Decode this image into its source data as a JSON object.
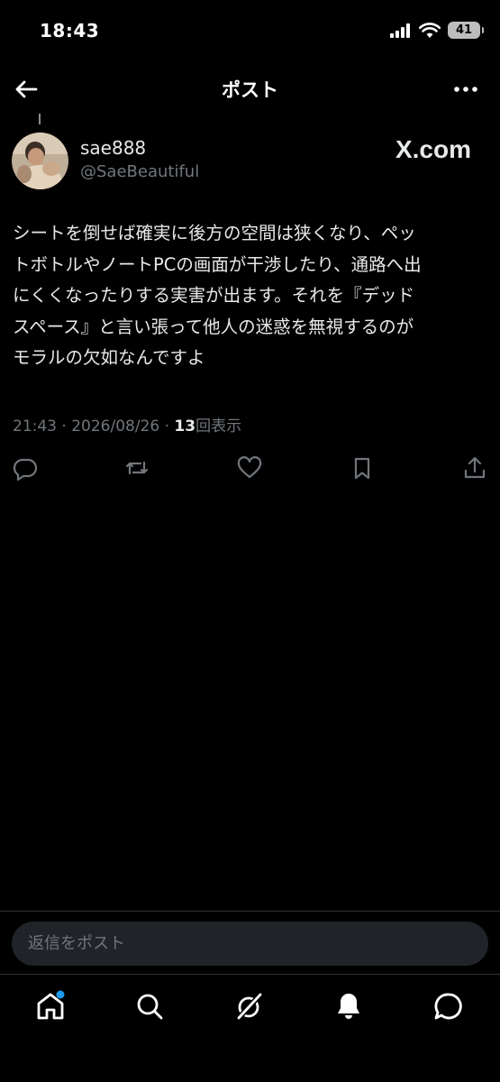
{
  "status_bar": {
    "time": "18:43",
    "battery": "41",
    "icons": [
      "signal-icon",
      "wifi-icon",
      "battery-icon"
    ]
  },
  "header": {
    "title": "ポスト",
    "back_icon": "back-arrow-icon",
    "more_icon": "more-icon"
  },
  "post": {
    "username": "sae888",
    "handle": "@SaeBeautiful",
    "watermark": "X.com",
    "lines": [
      "シートを倒せば確実に後方の空間は狭くなり、ペッ",
      "トボトルやノートPCの画面が干渉したり、通路へ出",
      "にくくなったりする実害が出ます。それを『デッド",
      "スペース』と言い張って他人の迷惑を無視するのが",
      "モラルの欠如なんですよ"
    ],
    "time": "21:43",
    "separator": "·",
    "date": "2026/08/26",
    "views_count": "13",
    "views_label": "回表示"
  },
  "actions": [
    "reply-icon",
    "repost-icon",
    "like-icon",
    "bookmark-icon",
    "share-icon"
  ],
  "reply": {
    "placeholder": "返信をポスト"
  },
  "nav": [
    "home-icon",
    "search-icon",
    "grok-icon",
    "notifications-icon",
    "messages-icon"
  ],
  "colors": {
    "background": "#000000",
    "text": "#e7e9ea",
    "muted": "#71767b",
    "accent": "#1d9bf0",
    "input_bg": "#202327"
  }
}
